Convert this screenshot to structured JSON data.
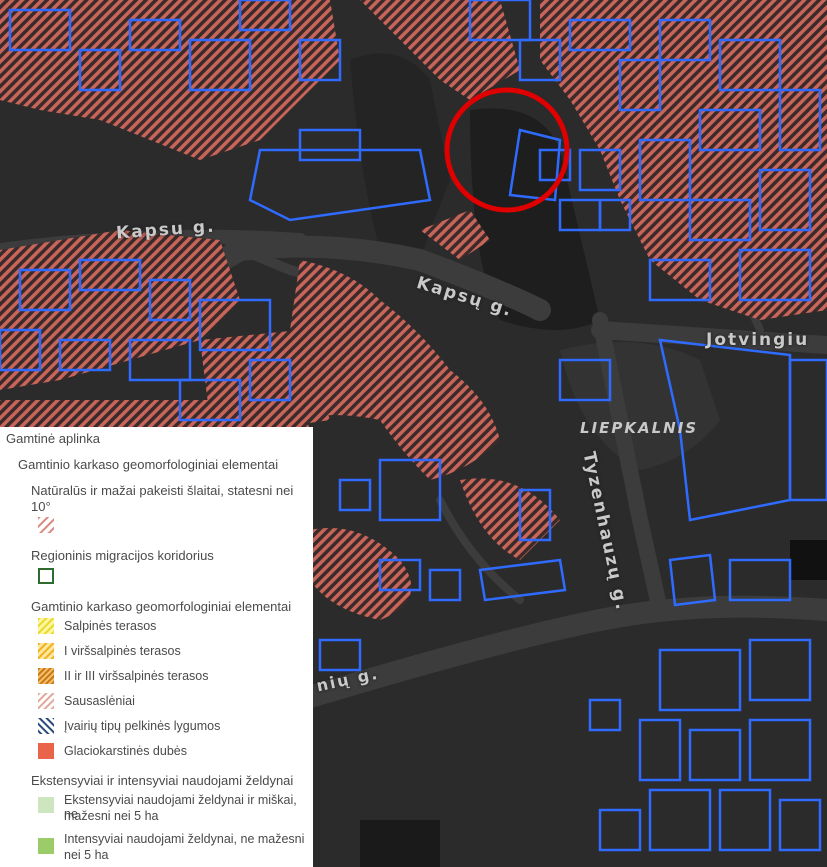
{
  "map": {
    "labels": {
      "street_kapsu_west": "Kapsu g.",
      "street_kapsu_center": "Kapsų g.",
      "street_jotvingiu": "Jotvingiu",
      "street_tyzenhauzu": "Tyzenhauzų g.",
      "street_bottom": "nių g.",
      "district": "LIEPKALNIS"
    },
    "colors": {
      "background": "#2b2b2b",
      "road": "#3a3a3a",
      "parcel_outline": "#2f6bff",
      "slope_hatch": "#c8655a",
      "highlight_circle": "#e00000"
    }
  },
  "legend": {
    "title": "Gamtinė aplinka",
    "group1": {
      "title": "Gamtinio karkaso geomorfologiniai elementai",
      "item1_line1": "Natūralūs ir mažai pakeisti šlaitai, statesni nei",
      "item1_line2": "10°",
      "item2": "Regioninis migracijos koridorius"
    },
    "group2": {
      "title": "Gamtinio karkaso geomorfologiniai elementai",
      "items": [
        "Salpinės terasos",
        "I viršsalpinės terasos",
        "II ir III viršsalpinės terasos",
        "Sausaslėniai",
        "Įvairių tipų pelkinės lygumos",
        "Glaciokarstinės dubės"
      ]
    },
    "group3": {
      "title": "Ekstensyviai ir intensyviai naudojami želdynai",
      "item1_line1": "Ekstensyviai naudojami želdynai ir miškai, ne",
      "item1_line2": "mažesni nei 5 ha",
      "item2_line1": "Intensyviai naudojami želdynai, ne mažesni",
      "item2_line2": "nei 5 ha"
    },
    "swatch_colors": {
      "slope": "#c8655a",
      "corridor": "#2e6b2e",
      "salpines": "#f2ea5a",
      "i_virs": "#f0c020",
      "ii_iii_virs": "#e09018",
      "sausasleniai": "#e2a89a",
      "pelkines": "#3a5a88",
      "glaciokarstines": "#e8644a",
      "ekstensyviai": "#cde6c0",
      "intensyviai": "#9ccc6a"
    }
  }
}
